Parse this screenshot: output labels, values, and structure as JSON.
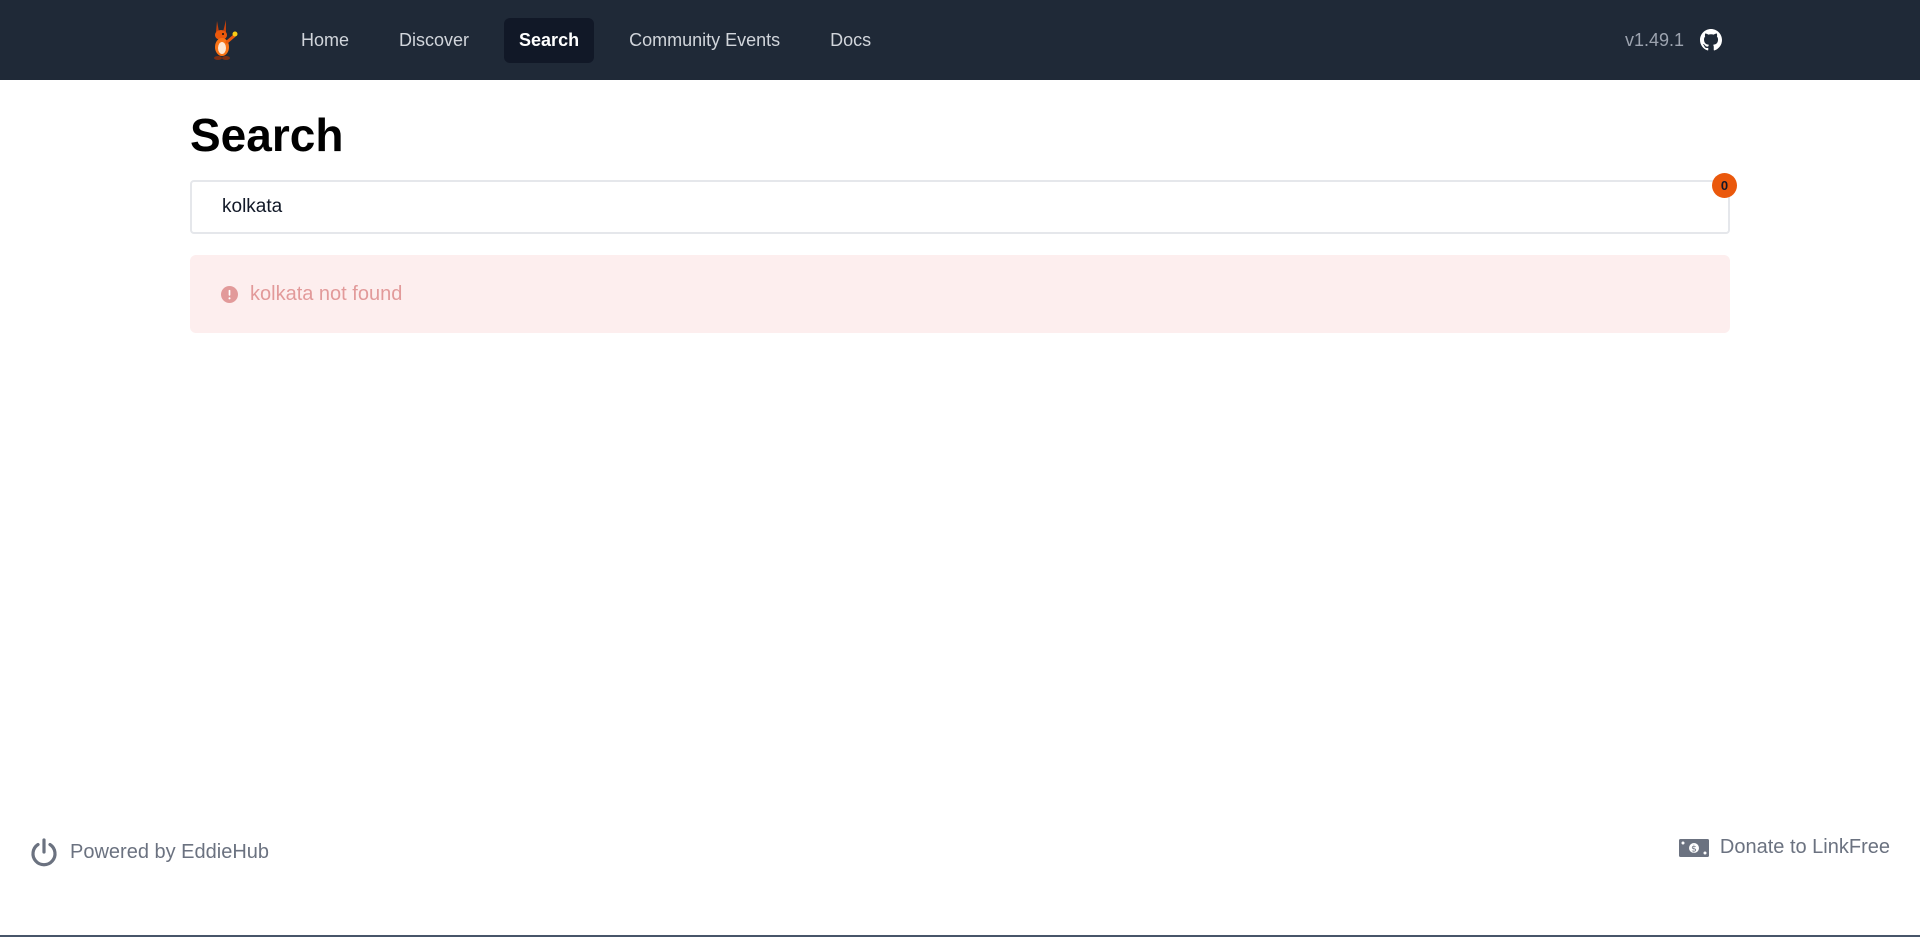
{
  "navbar": {
    "logo_icon": "linkfree-mascot-icon",
    "links": [
      {
        "label": "Home",
        "active": false
      },
      {
        "label": "Discover",
        "active": false
      },
      {
        "label": "Search",
        "active": true
      },
      {
        "label": "Community Events",
        "active": false
      },
      {
        "label": "Docs",
        "active": false
      }
    ],
    "version": "v1.49.1",
    "github_icon": "github-icon"
  },
  "main": {
    "title": "Search",
    "search": {
      "value": "kolkata",
      "placeholder": ""
    },
    "result_count": "0",
    "alert": {
      "icon": "exclamation-circle-icon",
      "message": "kolkata not found"
    }
  },
  "footer": {
    "left": {
      "icon": "power-icon",
      "label": "Powered by EddieHub"
    },
    "right": {
      "icon": "money-icon",
      "label": "Donate to LinkFree"
    }
  },
  "colors": {
    "navbar_bg": "#1f2937",
    "nav_active_bg": "#111827",
    "badge": "#ea580c",
    "alert_bg": "#fdeeee",
    "alert_text": "#e29a9a",
    "footer_text": "#6b7280"
  }
}
